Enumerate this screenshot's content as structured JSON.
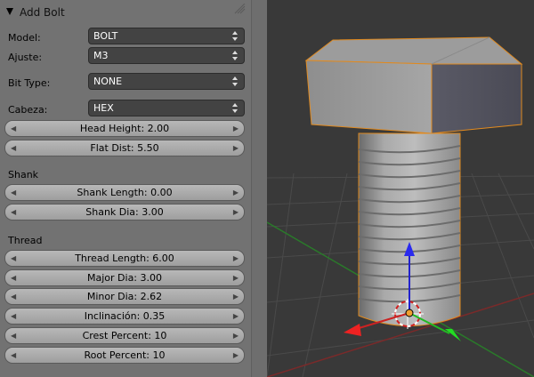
{
  "panel": {
    "title": "Add Bolt",
    "model": {
      "label": "Model:",
      "value": "BOLT"
    },
    "ajuste": {
      "label": "Ajuste:",
      "value": "M3"
    },
    "bit_type": {
      "label": "Bit Type:",
      "value": "NONE"
    },
    "cabeza": {
      "label": "Cabeza:",
      "value": "HEX"
    },
    "head_height": "Head Height: 2.00",
    "flat_dist": "Flat Dist: 5.50",
    "shank_section": "Shank",
    "shank_length": "Shank Length: 0.00",
    "shank_dia": "Shank Dia: 3.00",
    "thread_section": "Thread",
    "thread_length": "Thread Length: 6.00",
    "major_dia": "Major Dia: 3.00",
    "minor_dia": "Minor Dia: 2.62",
    "inclinacion": "Inclinación: 0.35",
    "crest_percent": "Crest Percent: 10",
    "root_percent": "Root Percent: 10"
  },
  "colors": {
    "panel_bg": "#727272",
    "menu_bg": "#434343",
    "viewport_bg": "#393939",
    "selection_outline": "#f29a29",
    "axis_x": "#d42020",
    "axis_y": "#20c020",
    "axis_z": "#2020d0"
  }
}
